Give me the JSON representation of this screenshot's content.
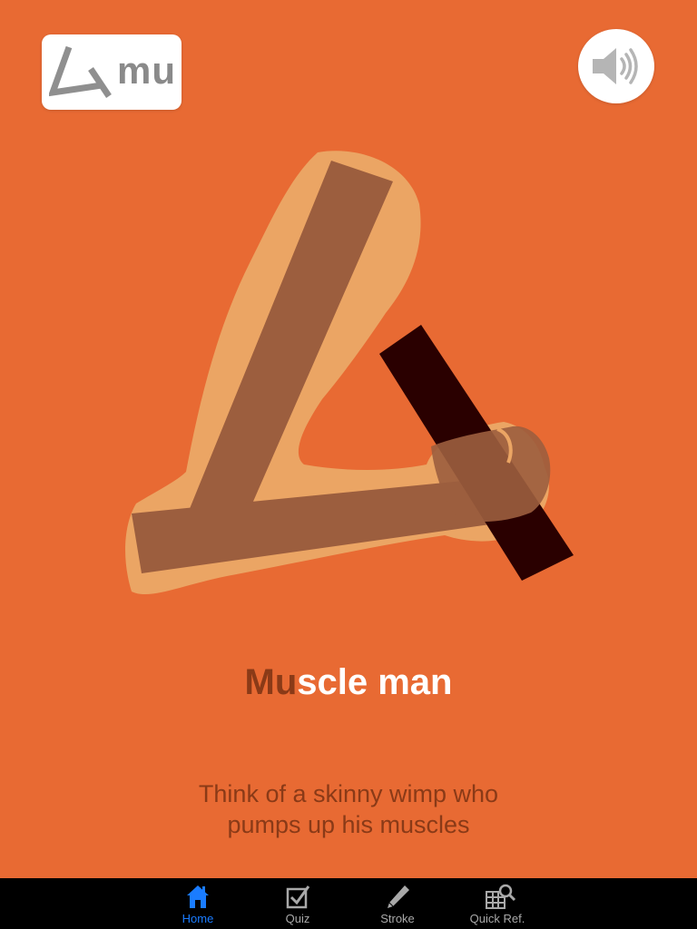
{
  "kana": {
    "romaji": "mu"
  },
  "sound_button": {
    "icon": "speaker-icon"
  },
  "mnemonic": {
    "title_highlight": "Mu",
    "title_rest": "scle man",
    "description_lines": [
      "Think of a skinny wimp who",
      "pumps up his muscles"
    ]
  },
  "tabbar": {
    "tabs": [
      {
        "label": "Home",
        "icon": "home-icon",
        "active": true
      },
      {
        "label": "Quiz",
        "icon": "checkbox-icon",
        "active": false
      },
      {
        "label": "Stroke",
        "icon": "pencil-icon",
        "active": false
      },
      {
        "label": "Quick Ref.",
        "icon": "grid-magnifier-icon",
        "active": false
      }
    ]
  },
  "colors": {
    "background": "#E86A33",
    "highlight_text": "#8A3A17",
    "tab_active": "#1a7cff",
    "tab_inactive": "#a9a9a9",
    "arm_skin": "#EBA564",
    "stroke_brown": "#9C5E3E",
    "stroke_dark": "#2A0000"
  }
}
